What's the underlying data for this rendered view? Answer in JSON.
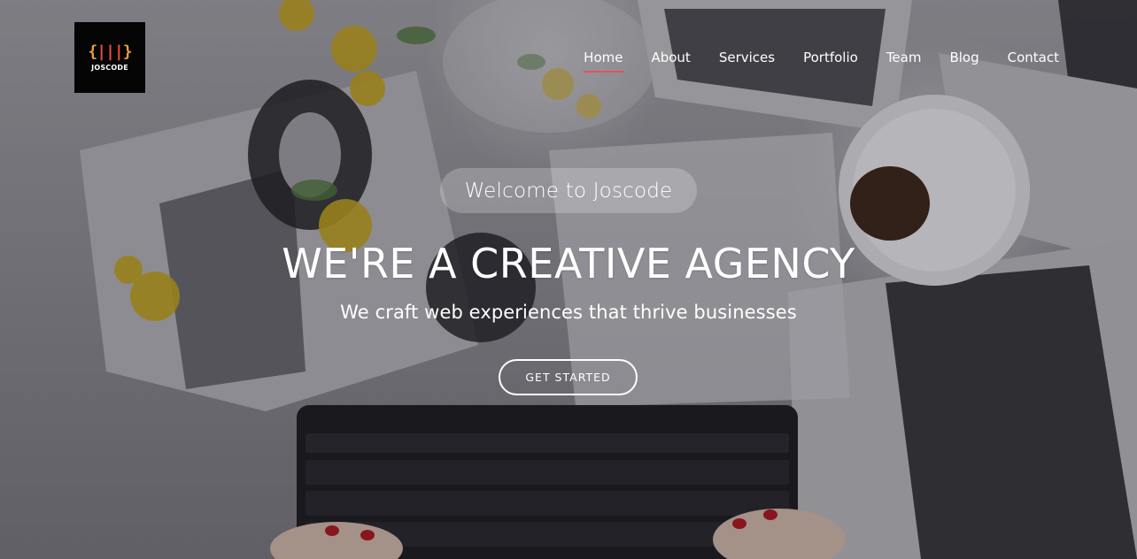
{
  "brand": {
    "logo_text": "JOSCODE",
    "accent_color": "#e8505b"
  },
  "nav": {
    "items": [
      {
        "label": "Home",
        "active": true
      },
      {
        "label": "About",
        "active": false
      },
      {
        "label": "Services",
        "active": false
      },
      {
        "label": "Portfolio",
        "active": false
      },
      {
        "label": "Team",
        "active": false
      },
      {
        "label": "Blog",
        "active": false
      },
      {
        "label": "Contact",
        "active": false
      }
    ]
  },
  "hero": {
    "welcome_text": "Welcome to Joscode",
    "headline": "WE'RE A CREATIVE AGENCY",
    "subheadline": "We craft web experiences that thrive businesses",
    "cta_label": "GET STARTED"
  },
  "background": {
    "description_icons": [
      "coffee-cup",
      "keyboard",
      "flower",
      "magazine-posters"
    ]
  }
}
